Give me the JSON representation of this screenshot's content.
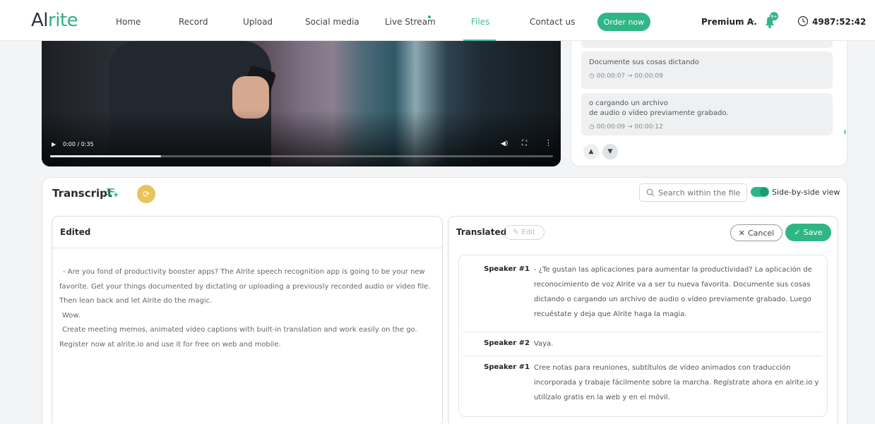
{
  "nav": {
    "logo_prefix": "Al",
    "logo_accent": "rite",
    "links": [
      "Home",
      "Record",
      "Upload",
      "Social media",
      "Live Stream",
      "Files",
      "Contact us"
    ],
    "active": "Files",
    "order_label": "Order now",
    "user_label": "Premium A.",
    "notification_badge": "9+",
    "timer": "4987:52:42"
  },
  "video": {
    "time_label": "0:00 / 0:35",
    "progress_fraction": 0.22
  },
  "subtitles": [
    {
      "text": "Documente sus cosas dictando",
      "time": "00:00:07 → 00:00:09"
    },
    {
      "text": "o cargando un archivo\nde audio o vídeo previamente grabado.",
      "time": "00:00:09 → 00:00:12"
    }
  ],
  "transcript": {
    "title": "Transcript",
    "search_placeholder": "Search within the file",
    "toggle_label": "Side-by-side view",
    "edited": {
      "title": "Edited",
      "paragraphs": [
        "- Are you fond of productivity booster apps? The Alrite speech recognition app is going to be your new favorite. Get your things documented by dictating or uploading a previously recorded audio or video file. Then lean back and let Alrite do the magic.",
        "Wow.",
        "Create meeting memos, animated video captions with built-in translation and work easily on the go. Register now at alrite.io and use it for free on web and mobile."
      ]
    },
    "translated": {
      "title": "Translated",
      "edit_label": "Edit",
      "cancel_label": "Cancel",
      "save_label": "Save",
      "segments": [
        {
          "speaker": "Speaker #1",
          "text": "- ¿Te gustan las aplicaciones para aumentar la productividad? La aplicación de reconocimiento de voz Alrite va a ser tu nueva favorita. Documente sus cosas dictando o cargando un archivo de audio o vídeo previamente grabado. Luego recuéstate y deja que Alrite haga la magia."
        },
        {
          "speaker": "Speaker #2",
          "text": "Vaya."
        },
        {
          "speaker": "Speaker #1",
          "text": "Cree notas para reuniones, subtítulos de vídeo animados con traducción incorporada y trabaje fácilmente sobre la marcha. Regístrate ahora en alrite.io y utilízalo gratis en la web y en el móvil."
        }
      ]
    }
  },
  "colors": {
    "accent": "#2fb686",
    "active_link": "#4ab9a0",
    "avatar": "#e8c45c"
  }
}
